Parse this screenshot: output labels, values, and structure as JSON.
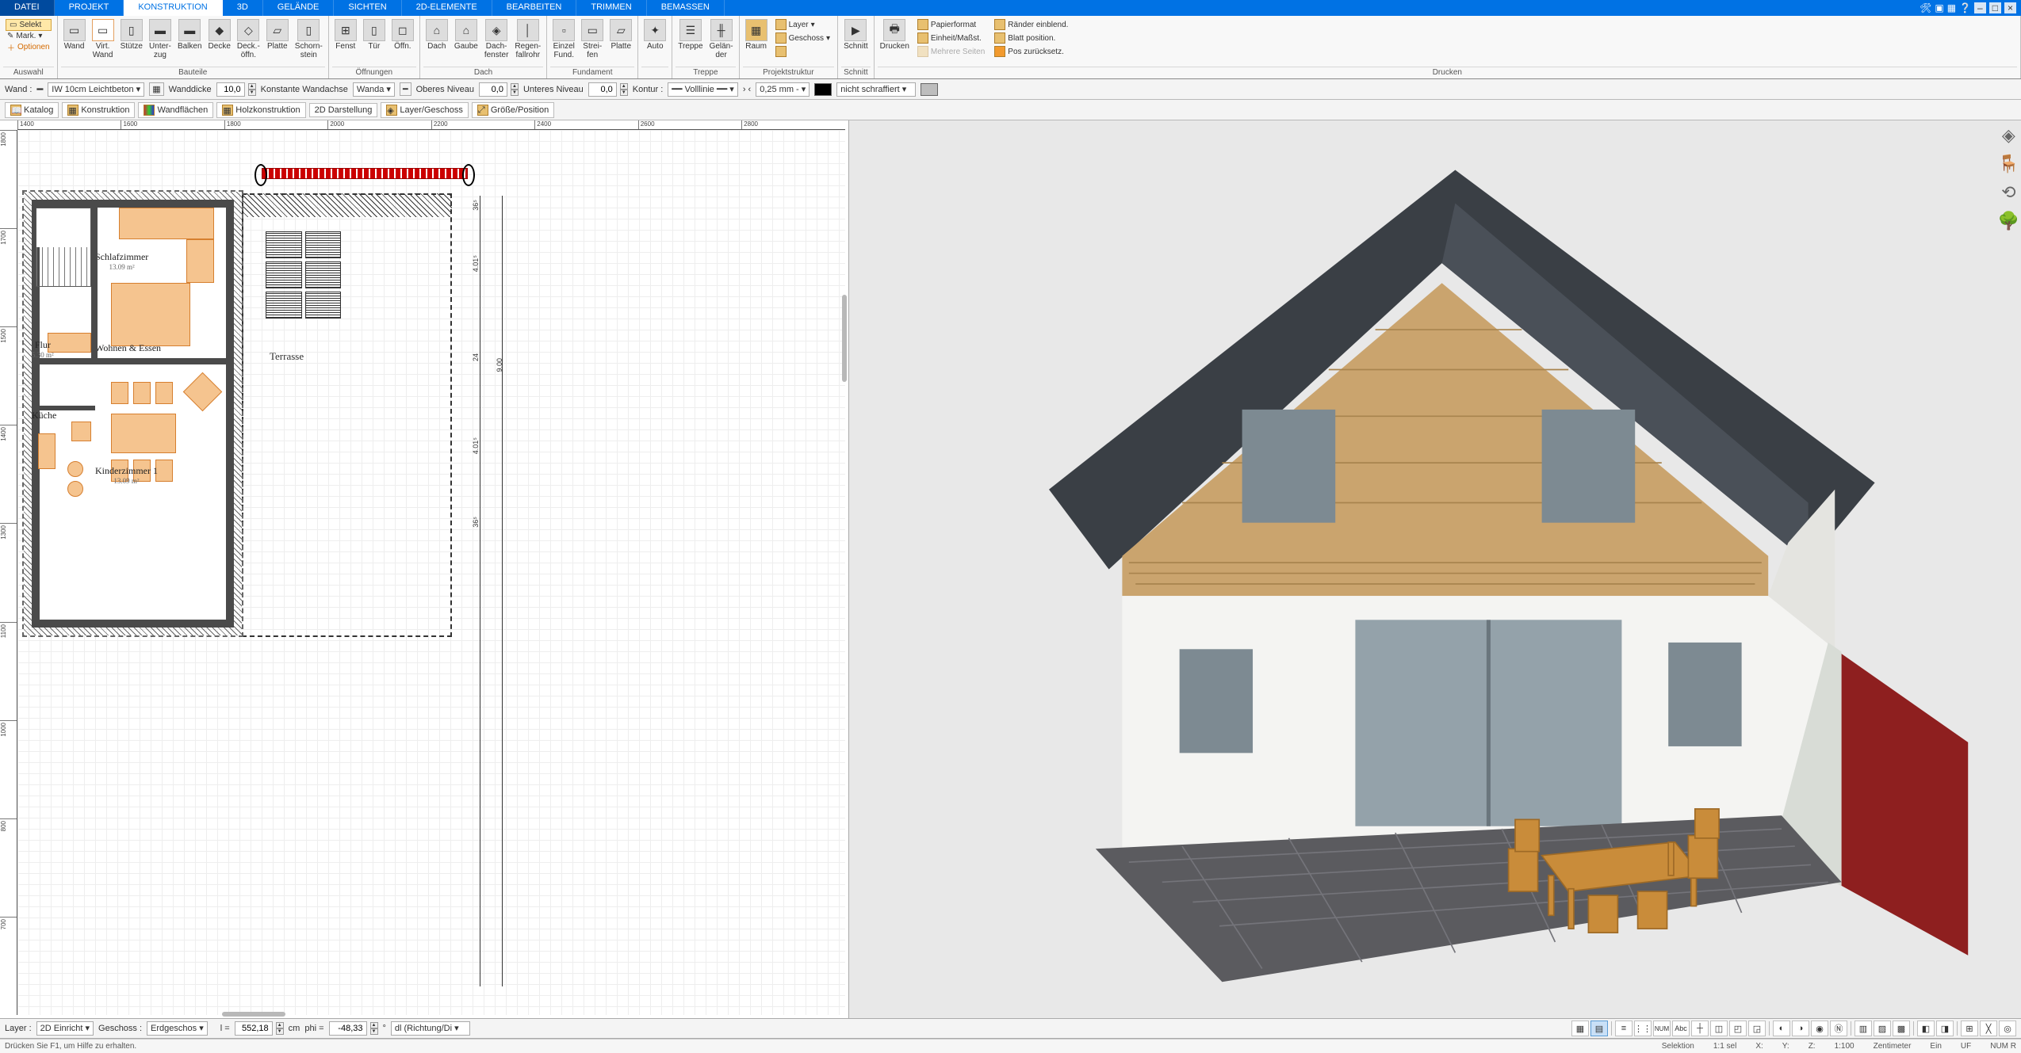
{
  "menu": {
    "tabs": [
      "DATEI",
      "PROJEKT",
      "KONSTRUKTION",
      "3D",
      "GELÄNDE",
      "SICHTEN",
      "2D-ELEMENTE",
      "BEARBEITEN",
      "TRIMMEN",
      "BEMASSEN"
    ],
    "active": 2
  },
  "ribbon": {
    "auswahl": {
      "label": "Auswahl",
      "selekt": "Selekt",
      "mark": "Mark.",
      "optionen": "Optionen"
    },
    "bauteile": {
      "label": "Bauteile",
      "items": [
        "Wand",
        "Virt.\nWand",
        "Stütze",
        "Unter-\nzug",
        "Balken",
        "Decke",
        "Deck.-\nöffn.",
        "Platte",
        "Schorn-\nstein"
      ]
    },
    "oeffnungen": {
      "label": "Öffnungen",
      "items": [
        "Fenst",
        "Tür",
        "Öffn."
      ]
    },
    "dach": {
      "label": "Dach",
      "items": [
        "Dach",
        "Gaube",
        "Dach-\nfenster",
        "Regen-\nfallrohr"
      ]
    },
    "fundament": {
      "label": "Fundament",
      "items": [
        "Einzel\nFund.",
        "Strei-\nfen",
        "Platte"
      ]
    },
    "auto": {
      "label": "",
      "items": [
        "Auto"
      ]
    },
    "treppe": {
      "label": "Treppe",
      "items": [
        "Treppe",
        "Gelän-\nder"
      ]
    },
    "projekt": {
      "label": "Projektstruktur",
      "raum": "Raum",
      "rows": [
        "Layer",
        "Geschoss",
        ""
      ]
    },
    "schnitt": {
      "label": "Schnitt",
      "items": [
        "Schnitt"
      ]
    },
    "drucken": {
      "label": "Drucken",
      "main": "Drucken",
      "rows": [
        "Papierformat",
        "Einheit/Maßst.",
        "Mehrere Seiten",
        "Ränder einblend.",
        "Blatt position.",
        "Pos zurücksetz."
      ]
    }
  },
  "prop": {
    "wand": "Wand :",
    "wandtype": "IW 10cm Leichtbeton",
    "wanddicke": "Wanddicke",
    "wanddickeV": "10,0",
    "achse": "Konstante Wandachse",
    "achseSel": "Wanda",
    "oberes": "Oberes Niveau",
    "oberesV": "0,0",
    "unteres": "Unteres Niveau",
    "unteresV": "0,0",
    "kontur": "Kontur :",
    "line": "Volllinie",
    "width": "0,25 mm",
    "fill": "nicht schraffiert"
  },
  "tools": {
    "items": [
      "Katalog",
      "Konstruktion",
      "Wandflächen",
      "Holzkonstruktion",
      "2D Darstellung",
      "Layer/Geschoss",
      "Größe/Position"
    ]
  },
  "plan": {
    "rulerX": [
      "1400",
      "1600",
      "1800",
      "2000",
      "2200",
      "2400",
      "2600",
      "2800"
    ],
    "rulerY": [
      "1800",
      "1700",
      "1500",
      "1400",
      "1300",
      "1100",
      "1000",
      "800",
      "700"
    ],
    "rooms": {
      "schlaf": "Schlafzimmer",
      "schlafA": "13.09 m²",
      "wohnen": "Wohnen & Essen",
      "flur": "Flur",
      "flurA": "5.30 m²",
      "kueche": "Küche",
      "kinder": "Kinderzimmer 1",
      "kinderA": "13.09 m²",
      "terrasse": "Terrasse"
    },
    "dims": {
      "d1": "4.01⁵",
      "d2": "24",
      "d3": "4.01⁵",
      "d4": "36⁵",
      "d5": "36⁵",
      "d6": "9.00"
    }
  },
  "bottom": {
    "layer": "Layer :",
    "layerV": "2D Einricht",
    "geschoss": "Geschoss :",
    "geschossV": "Erdgeschos",
    "l": "l =",
    "lV": "552,18",
    "cm": "cm",
    "phi": "phi =",
    "phiV": "-48,33",
    "deg": "°",
    "dlr": "dl (Richtung/Di"
  },
  "status": {
    "help": "Drücken Sie F1, um Hilfe zu erhalten.",
    "sel": "Selektion",
    "scale": "1:1 sel",
    "x": "X:",
    "y": "Y:",
    "z": "Z:",
    "sc2": "1:100",
    "unit": "Zentimeter",
    "ein": "Ein",
    "uf": "UF",
    "num": "NUM R"
  }
}
